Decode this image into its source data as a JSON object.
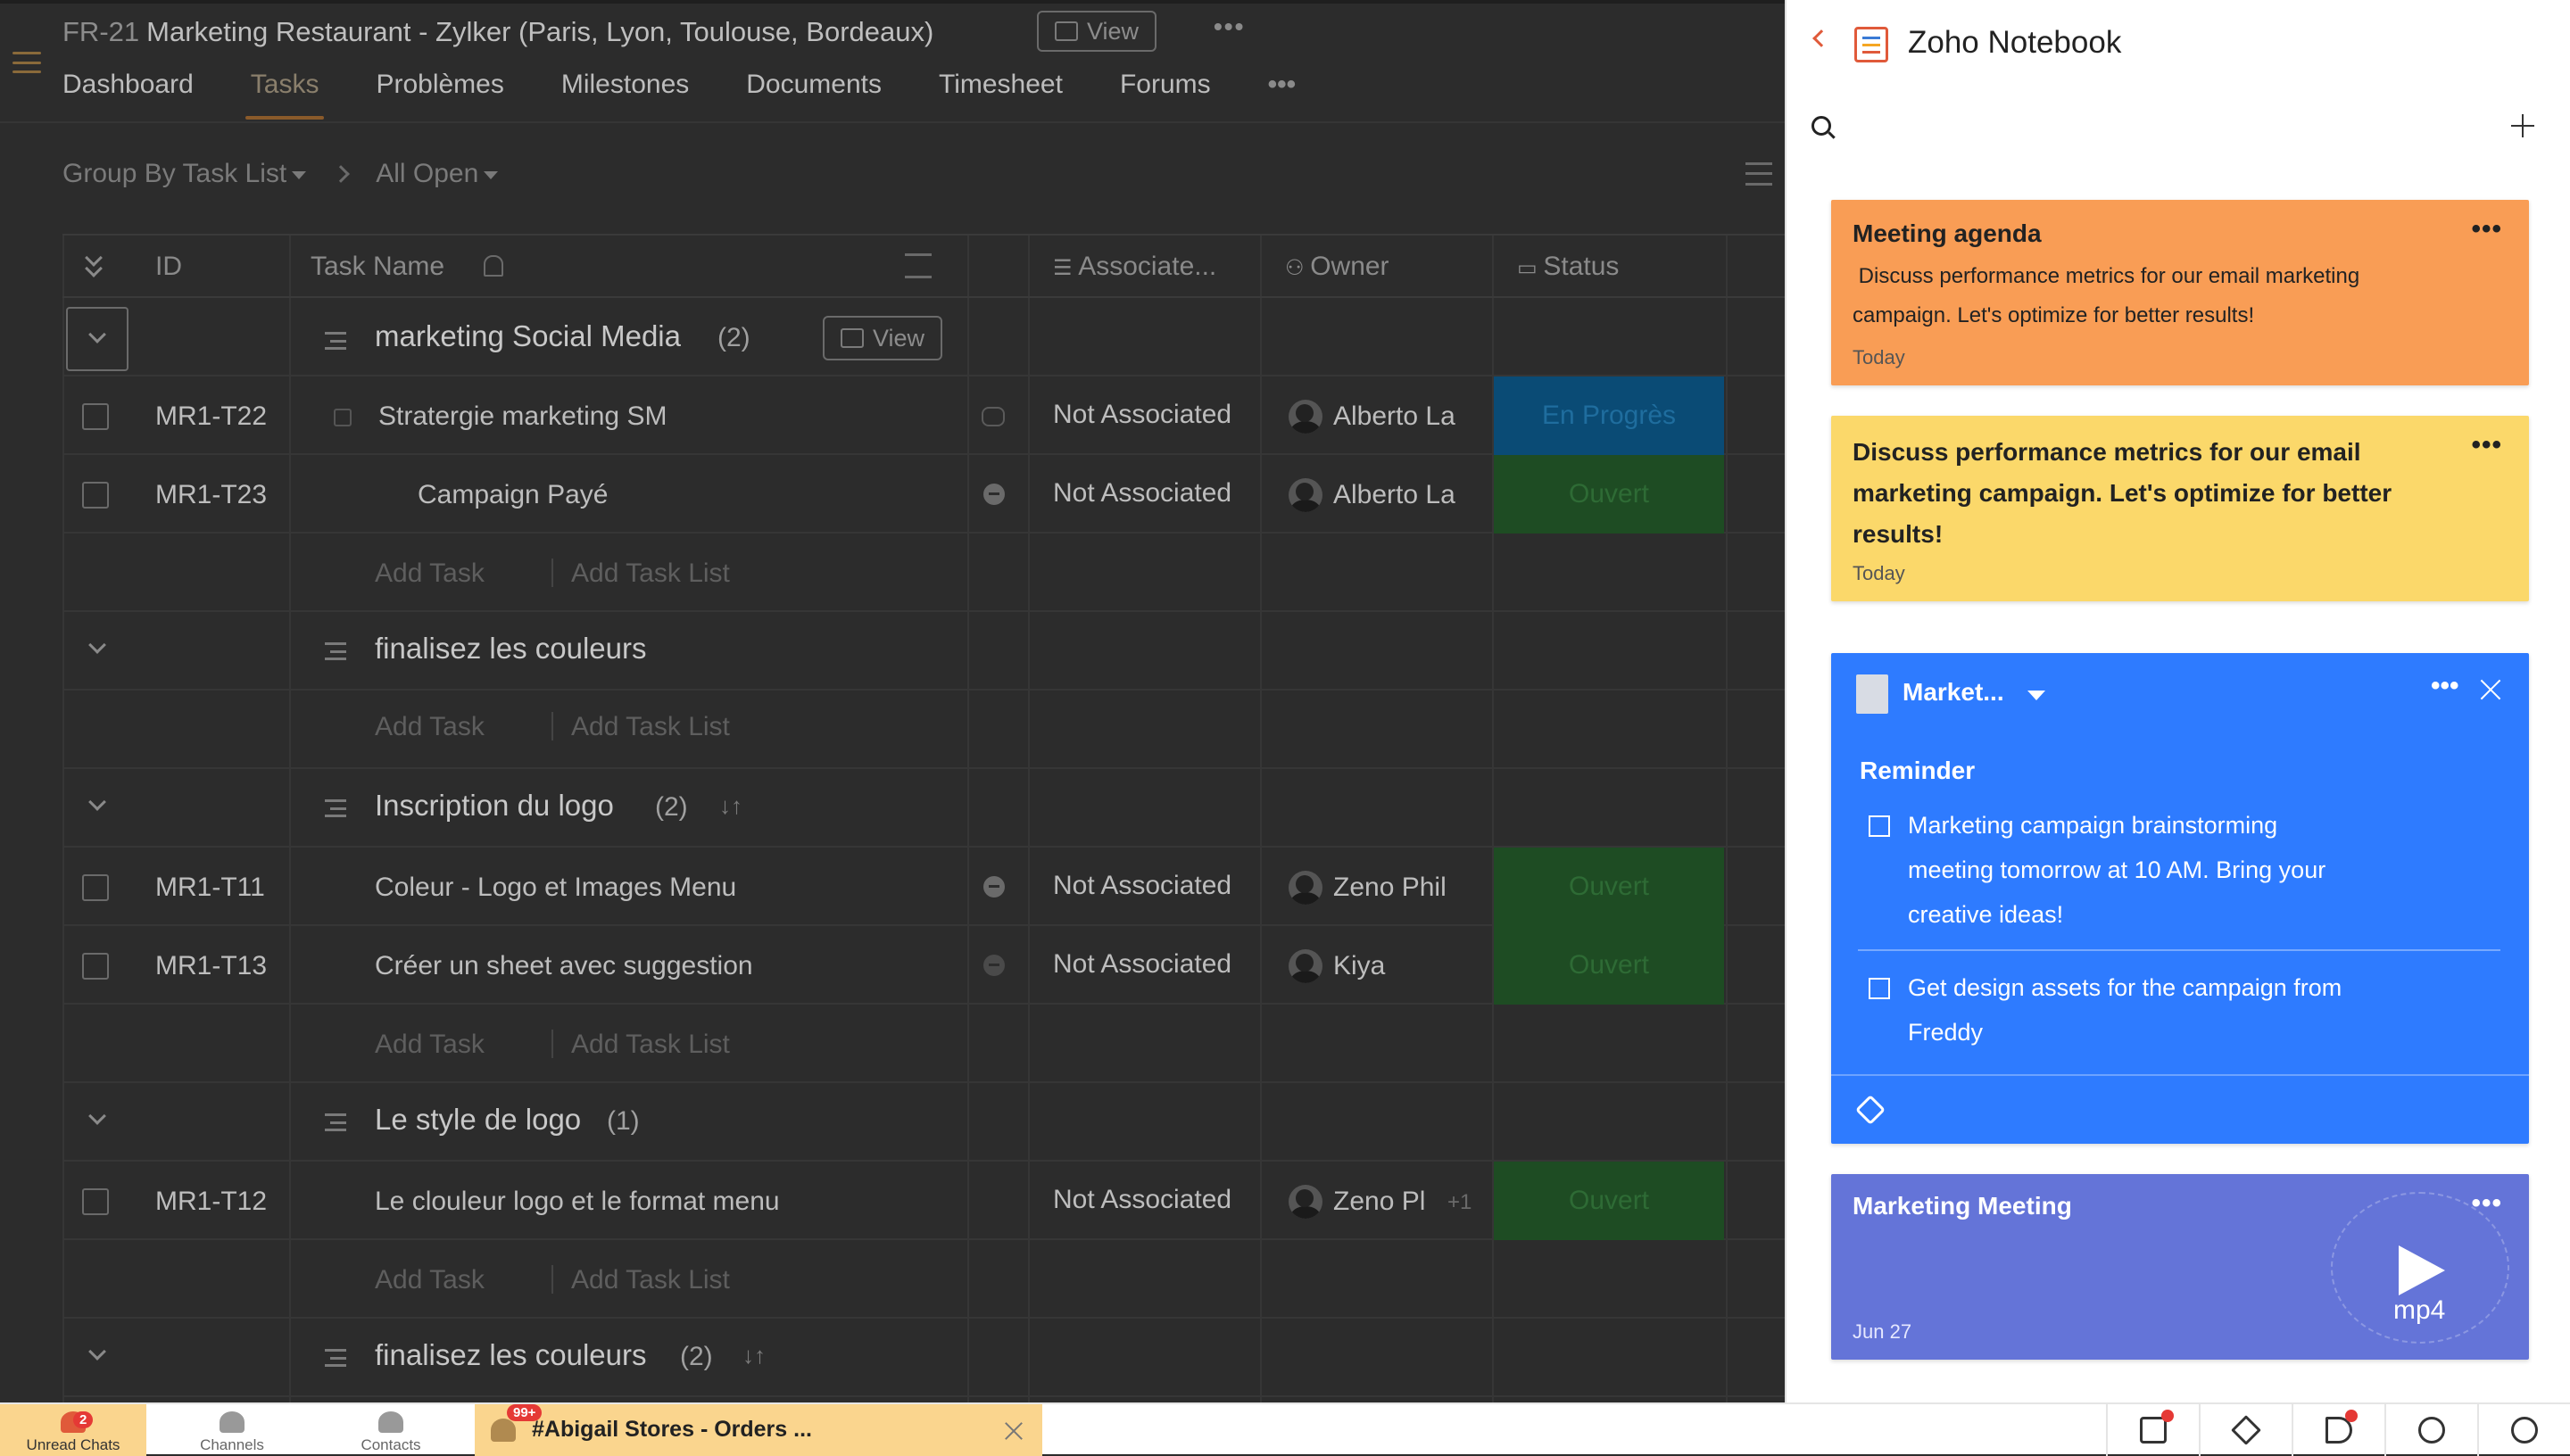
{
  "project": {
    "code": "FR-21",
    "title": "Marketing Restaurant - Zylker (Paris, Lyon, Toulouse, Bordeaux)",
    "view_label": "View"
  },
  "nav": {
    "tabs": [
      "Dashboard",
      "Tasks",
      "Problèmes",
      "Milestones",
      "Documents",
      "Timesheet",
      "Forums"
    ],
    "active": "Tasks",
    "more": "•••"
  },
  "filters": {
    "group_by": "Group By Task List",
    "status": "All Open"
  },
  "columns": {
    "id": "ID",
    "task_name": "Task Name",
    "associated": "Associate...",
    "owner": "Owner",
    "status": "Status"
  },
  "add_task": "Add Task",
  "add_task_list": "Add Task List",
  "groups": [
    {
      "name": "marketing Social Media",
      "count": "(2)",
      "view_label": "View"
    },
    {
      "name": "finalisez les couleurs",
      "count": ""
    },
    {
      "name": "Inscription du logo",
      "count": "(2)"
    },
    {
      "name": "Le style de logo",
      "count": "(1)"
    },
    {
      "name": "finalisez les couleurs",
      "count": "(2)"
    }
  ],
  "tasks": [
    {
      "id": "MR1-T22",
      "name": "Stratergie marketing SM",
      "associated": "Not Associated",
      "owner": "Alberto La",
      "status": "En Progrès"
    },
    {
      "id": "MR1-T23",
      "name": "Campaign Payé",
      "associated": "Not Associated",
      "owner": "Alberto La",
      "status": "Ouvert"
    },
    {
      "id": "MR1-T11",
      "name": "Coleur - Logo et Images Menu",
      "associated": "Not Associated",
      "owner": "Zeno Phil",
      "status": "Ouvert"
    },
    {
      "id": "MR1-T13",
      "name": "Créer un sheet avec suggestion",
      "associated": "Not Associated",
      "owner": "Kiya",
      "status": "Ouvert"
    },
    {
      "id": "MR1-T12",
      "name": "Le clouleur logo et le format menu",
      "associated": "Not Associated",
      "owner": "Zeno Pl",
      "owner_extra": "+1",
      "status": "Ouvert"
    }
  ],
  "notebook": {
    "title": "Zoho Notebook",
    "cards": [
      {
        "title": "Meeting agenda",
        "body_lines": [
          " Discuss performance metrics for our email marketing",
          "campaign. Let's optimize for better results!"
        ],
        "date": "Today",
        "more": "•••"
      },
      {
        "title_lines": [
          "Discuss performance metrics for our email",
          "marketing campaign. Let's optimize for better",
          "results!"
        ],
        "date": "Today",
        "more": "•••"
      },
      {
        "notebook_name": "Market...",
        "section": "Reminder",
        "todos": [
          {
            "lines": [
              "Marketing campaign brainstorming",
              "meeting tomorrow at 10 AM. Bring your",
              "creative ideas!"
            ]
          },
          {
            "lines": [
              "Get design assets for the campaign from",
              "Freddy"
            ]
          }
        ],
        "more": "•••"
      },
      {
        "title": "Marketing Meeting",
        "date": "Jun 27",
        "format": "mp4",
        "more": "•••"
      }
    ]
  },
  "bottom_bar": {
    "unread_chats": "Unread Chats",
    "unread_badge": "2",
    "channels": "Channels",
    "contacts": "Contacts",
    "chat_tab_title": "#Abigail Stores - Orders ...",
    "chat_badge": "99+"
  },
  "colors": {
    "accent": "#e05a3a",
    "status_progress": "#0a4b75",
    "status_open": "#1e4c23",
    "card_orange": "#f99d55",
    "card_yellow": "#fbd86a",
    "card_blue": "#2e7bff",
    "card_purple": "#6474d8"
  }
}
